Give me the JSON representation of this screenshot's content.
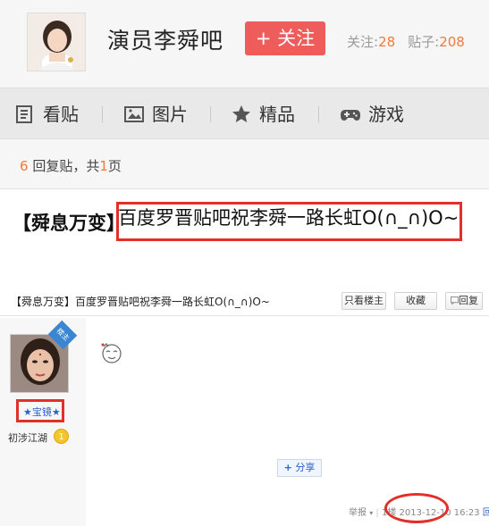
{
  "header": {
    "forum_title": "演员李舜吧",
    "follow_label": "+ 关注",
    "follow_count_label": "关注:",
    "follow_count": "28",
    "post_count_label": "贴子:",
    "post_count": "208"
  },
  "nav": {
    "items": [
      {
        "label": "看贴",
        "icon": "document-icon"
      },
      {
        "label": "图片",
        "icon": "image-icon"
      },
      {
        "label": "精品",
        "icon": "star-icon"
      },
      {
        "label": "游戏",
        "icon": "gamepad-icon"
      }
    ]
  },
  "reply_bar": {
    "count": "6",
    "text1": "回复贴，共",
    "pages": "1",
    "text2": "页"
  },
  "post": {
    "prefix": "【舜息万变】",
    "title": "百度罗晋贴吧祝李舜一路长虹O(∩_∩)O~"
  },
  "desktop": {
    "title": "【舜息万变】百度罗晋贴吧祝李舜一路长虹O(∩_∩)O~",
    "btn_only_op": "只看楼主",
    "btn_favorite": "收藏",
    "btn_reply": "回复",
    "badge": "楼主",
    "username": "★宝镜★",
    "level_name": "初涉江湖",
    "level_num": "1",
    "share_label": "分享",
    "footer_report": "举报",
    "footer_floor": "1楼",
    "footer_time": "2013-12-10 16:23",
    "footer_reply": "回复"
  },
  "colors": {
    "accent_red": "#ee5d5b",
    "highlight_red": "#e0302a",
    "count_orange": "#f07a3a",
    "link_blue": "#2b62c4"
  }
}
